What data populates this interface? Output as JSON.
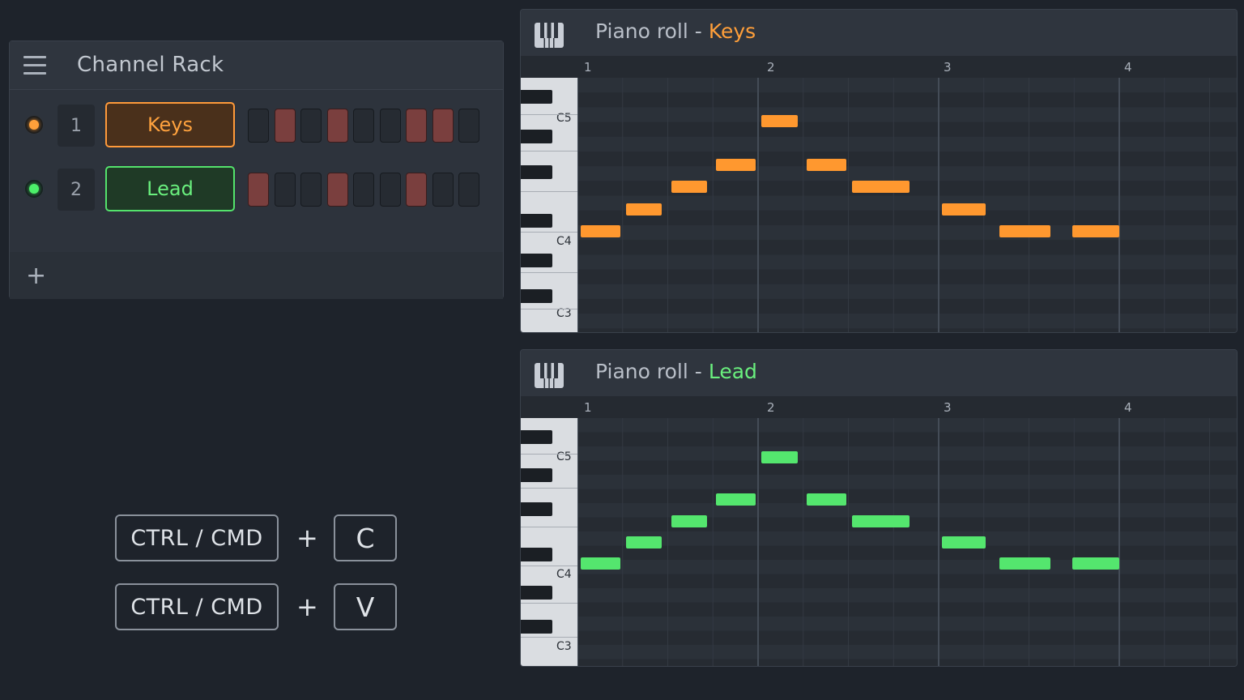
{
  "channel_rack": {
    "title": "Channel Rack",
    "channels": [
      {
        "number": "1",
        "name": "Keys",
        "led": "orange",
        "steps": [
          false,
          true,
          false,
          true,
          false,
          false,
          true,
          true,
          false
        ]
      },
      {
        "number": "2",
        "name": "Lead",
        "led": "green",
        "steps": [
          true,
          false,
          false,
          true,
          false,
          false,
          true,
          false,
          false
        ]
      }
    ]
  },
  "piano_rolls": [
    {
      "title_prefix": "Piano roll",
      "separator": "-",
      "channel": "Keys",
      "color": "#ff982f",
      "bars": [
        "1",
        "2",
        "3",
        "4"
      ],
      "octave_labels": [
        "C5",
        "C4",
        "C3"
      ],
      "notes": [
        {
          "start": 0.0,
          "length": 0.22,
          "pitch": 0
        },
        {
          "start": 0.25,
          "length": 0.2,
          "pitch": 1
        },
        {
          "start": 0.5,
          "length": 0.2,
          "pitch": 2
        },
        {
          "start": 0.75,
          "length": 0.22,
          "pitch": 3
        },
        {
          "start": 1.0,
          "length": 0.2,
          "pitch": 5
        },
        {
          "start": 1.25,
          "length": 0.22,
          "pitch": 3
        },
        {
          "start": 1.5,
          "length": 0.32,
          "pitch": 2
        },
        {
          "start": 2.0,
          "length": 0.24,
          "pitch": 1
        },
        {
          "start": 2.32,
          "length": 0.28,
          "pitch": 0
        },
        {
          "start": 2.72,
          "length": 0.26,
          "pitch": 0
        }
      ]
    },
    {
      "title_prefix": "Piano roll",
      "separator": "-",
      "channel": "Lead",
      "color": "#54e66e",
      "bars": [
        "1",
        "2",
        "3",
        "4"
      ],
      "octave_labels": [
        "C5",
        "C4",
        "C3"
      ],
      "notes": [
        {
          "start": 0.0,
          "length": 0.22,
          "pitch": 0
        },
        {
          "start": 0.25,
          "length": 0.2,
          "pitch": 1
        },
        {
          "start": 0.5,
          "length": 0.2,
          "pitch": 2
        },
        {
          "start": 0.75,
          "length": 0.22,
          "pitch": 3
        },
        {
          "start": 1.0,
          "length": 0.2,
          "pitch": 5
        },
        {
          "start": 1.25,
          "length": 0.22,
          "pitch": 3
        },
        {
          "start": 1.5,
          "length": 0.32,
          "pitch": 2
        },
        {
          "start": 2.0,
          "length": 0.24,
          "pitch": 1
        },
        {
          "start": 2.32,
          "length": 0.28,
          "pitch": 0
        },
        {
          "start": 2.72,
          "length": 0.26,
          "pitch": 0
        }
      ]
    }
  ],
  "shortcuts": [
    {
      "modifier": "CTRL / CMD",
      "plus": "+",
      "key": "C"
    },
    {
      "modifier": "CTRL / CMD",
      "plus": "+",
      "key": "V"
    }
  ]
}
